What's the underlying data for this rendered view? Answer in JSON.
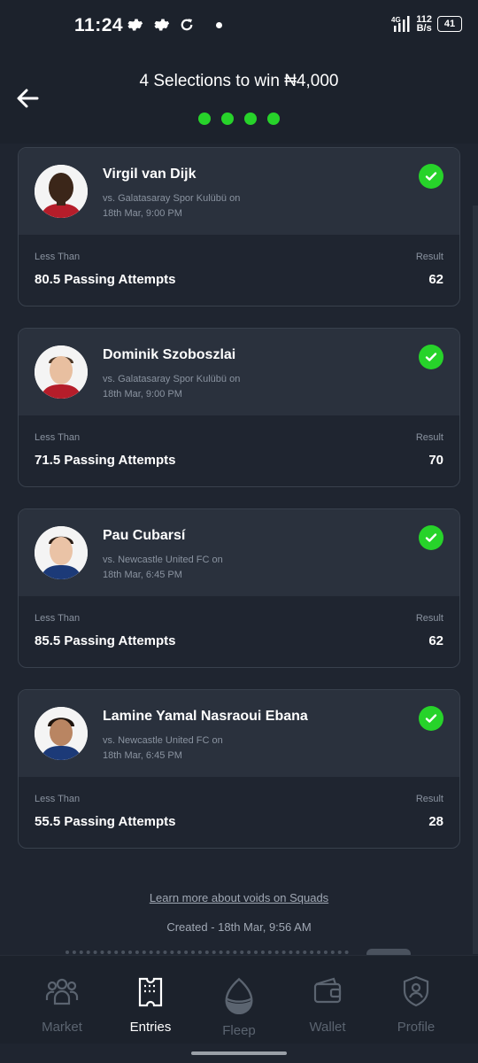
{
  "status_bar": {
    "time": "11:24",
    "signal_label": "4G",
    "net_speed_value": "112",
    "net_speed_unit": "B/s",
    "battery": "41"
  },
  "header": {
    "title": "4 Selections to win ₦4,000",
    "progress_dots": 4,
    "accent_color": "#27d32a"
  },
  "selections": [
    {
      "player": "Virgil van Dijk",
      "opponent": "vs. Galatasaray Spor Kulübü on",
      "date": "18th Mar, 9:00 PM",
      "condition_label": "Less Than",
      "line": "80.5 Passing Attempts",
      "result_label": "Result",
      "result": "62"
    },
    {
      "player": "Dominik Szoboszlai",
      "opponent": "vs. Galatasaray Spor Kulübü on",
      "date": "18th Mar, 9:00 PM",
      "condition_label": "Less Than",
      "line": "71.5 Passing Attempts",
      "result_label": "Result",
      "result": "70"
    },
    {
      "player": "Pau Cubarsí",
      "opponent": "vs. Newcastle United FC on",
      "date": "18th Mar, 6:45 PM",
      "condition_label": "Less Than",
      "line": "85.5 Passing Attempts",
      "result_label": "Result",
      "result": "62"
    },
    {
      "player": "Lamine Yamal Nasraoui Ebana",
      "opponent": "vs. Newcastle United FC on",
      "date": "18th Mar, 6:45 PM",
      "condition_label": "Less Than",
      "line": "55.5 Passing Attempts",
      "result_label": "Result",
      "result": "28"
    }
  ],
  "footer": {
    "learn_link": "Learn more about voids on Squads",
    "created": "Created - 18th Mar, 9:56 AM"
  },
  "nav": {
    "items": [
      {
        "label": "Market",
        "icon": "people-icon"
      },
      {
        "label": "Entries",
        "icon": "ticket-icon"
      },
      {
        "label": "Fleep",
        "icon": "fleep-icon"
      },
      {
        "label": "Wallet",
        "icon": "wallet-icon"
      },
      {
        "label": "Profile",
        "icon": "shield-icon"
      }
    ],
    "active": "Entries"
  }
}
